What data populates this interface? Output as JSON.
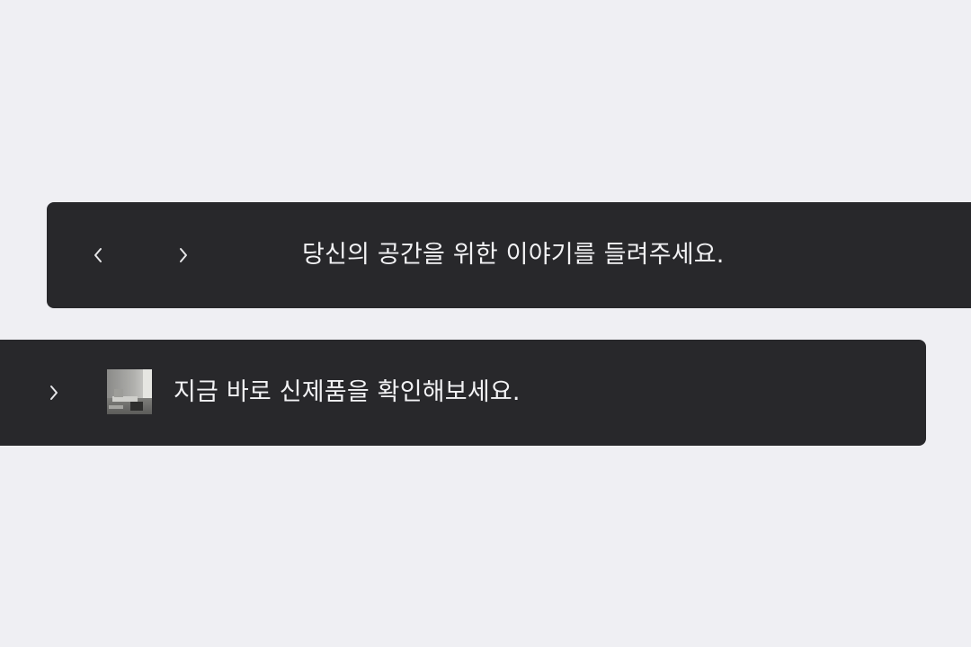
{
  "banners": [
    {
      "message": "당신의 공간을 위한 이야기를 들려주세요.",
      "nav": {
        "prev_icon": "chevron-left-icon",
        "next_icon": "chevron-right-icon"
      }
    },
    {
      "message": "지금 바로 신제품을 확인해보세요.",
      "nav": {
        "next_icon": "chevron-right-icon"
      },
      "thumbnail": "product-thumbnail"
    }
  ],
  "colors": {
    "background": "#efeff3",
    "banner": "#28282b",
    "text": "#f2f2f4"
  }
}
